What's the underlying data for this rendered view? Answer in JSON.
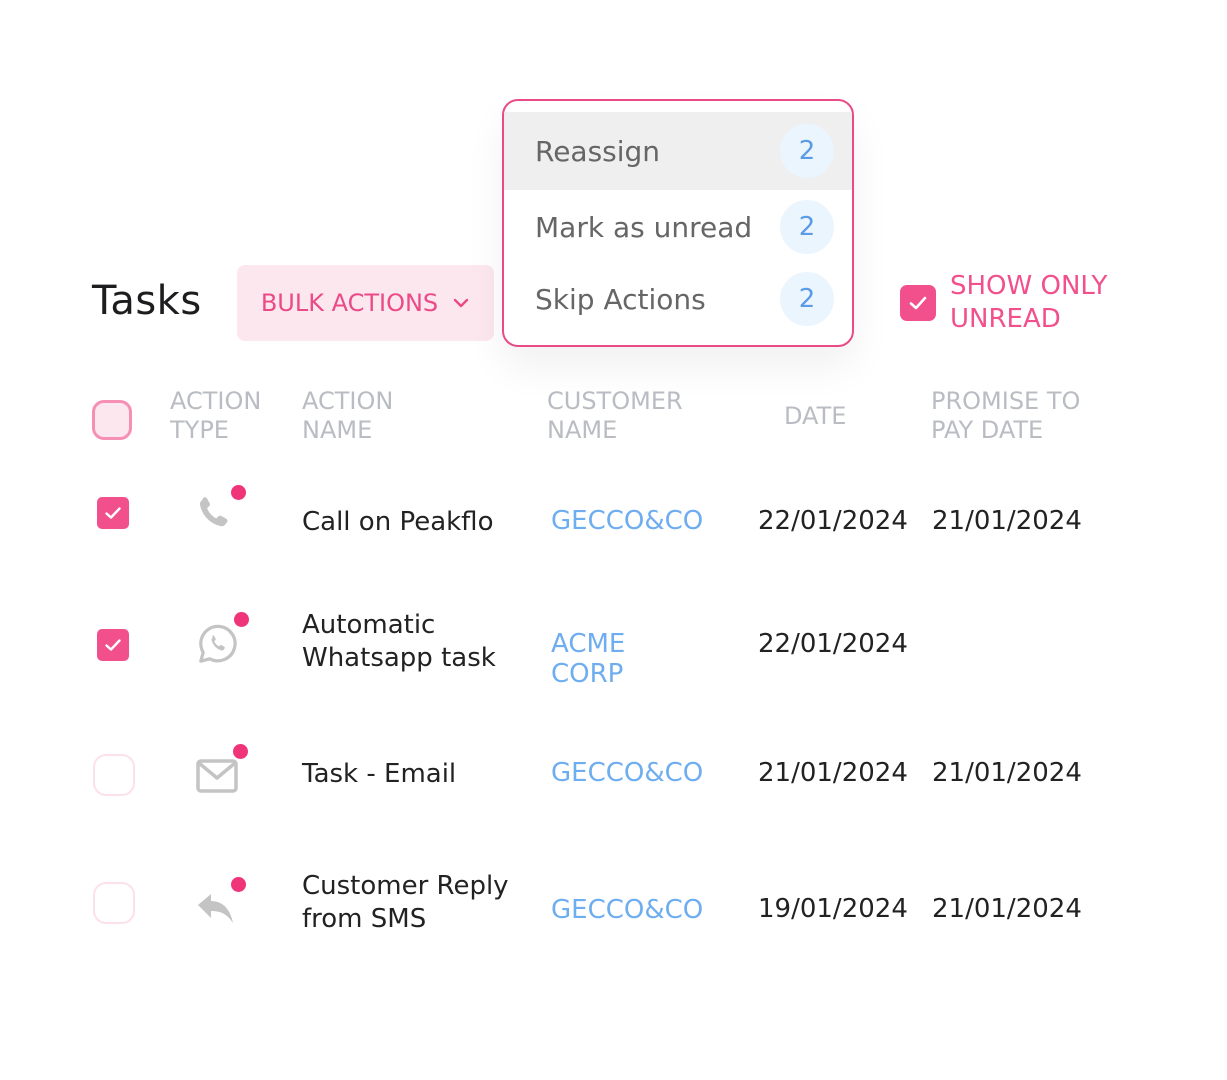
{
  "header": {
    "title": "Tasks",
    "bulk_actions_label": "BULK ACTIONS"
  },
  "bulk_menu": {
    "items": [
      {
        "label": "Reassign",
        "count": "2",
        "highlighted": true
      },
      {
        "label": "Mark as unread",
        "count": "2",
        "highlighted": false
      },
      {
        "label": "Skip Actions",
        "count": "2",
        "highlighted": false
      }
    ]
  },
  "filter": {
    "show_only_unread_label": "SHOW ONLY UNREAD",
    "checked": true
  },
  "table": {
    "columns": [
      "ACTION TYPE",
      "ACTION NAME",
      "CUSTOMER NAME",
      "DATE",
      "PROMISE TO PAY DATE"
    ],
    "column_lines": [
      [
        "ACTION",
        "TYPE"
      ],
      [
        "ACTION",
        "NAME"
      ],
      [
        "CUSTOMER",
        "NAME"
      ],
      [
        "DATE"
      ],
      [
        "PROMISE TO",
        "PAY DATE"
      ]
    ],
    "rows": [
      {
        "checked": true,
        "action_type": "phone-icon",
        "unread": true,
        "action_name": "Call on Peakflo",
        "customer": "GECCO&CO",
        "date": "22/01/2024",
        "promise_date": "21/01/2024"
      },
      {
        "checked": true,
        "action_type": "whatsapp-icon",
        "unread": true,
        "action_name": "Automatic Whatsapp task",
        "customer": "ACME CORP",
        "date": "22/01/2024",
        "promise_date": ""
      },
      {
        "checked": false,
        "action_type": "email-icon",
        "unread": true,
        "action_name": "Task - Email",
        "customer": "GECCO&CO",
        "date": "21/01/2024",
        "promise_date": "21/01/2024"
      },
      {
        "checked": false,
        "action_type": "reply-icon",
        "unread": true,
        "action_name": "Customer Reply from SMS",
        "customer": "GECCO&CO",
        "date": "19/01/2024",
        "promise_date": "21/01/2024"
      }
    ]
  },
  "colors": {
    "accent": "#f2508c",
    "link": "#6eadf0",
    "header_text": "#b9bcc2"
  }
}
